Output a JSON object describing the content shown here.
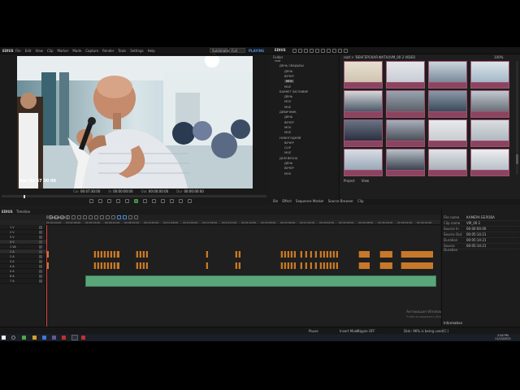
{
  "menubar": {
    "logo": "EDIUS",
    "items": [
      "File",
      "Edit",
      "View",
      "Clip",
      "Marker",
      "Mode",
      "Capture",
      "Render",
      "Tools",
      "Settings",
      "Help"
    ],
    "preset": "Sublimation vs.",
    "preset2": "Full",
    "badge": "PLAYING",
    "logo2": "EDIUS"
  },
  "preview": {
    "timecode": "Rec 03 47 30 00",
    "cur_label": "Cur",
    "cur_value": "00:47:30:00",
    "in_label": "In",
    "in_value": "00:00:00:00",
    "out_label": "Out",
    "out_value": "00:00:00:00",
    "dur_label": "Dur",
    "dur_value": "00:00:00:00"
  },
  "bin": {
    "tree_header": "Folder",
    "path": "root > 'ВЕНГЕРСКАЯ ФАТА/\\VM_00 2 VIDEO",
    "zoom": "100%",
    "tree": [
      {
        "label": "root",
        "level": 0
      },
      {
        "label": "ДЕНЬ СВАДЬБЫ",
        "level": 1
      },
      {
        "label": "ДЕНЬ",
        "level": 2
      },
      {
        "label": "ВЕЧЕР",
        "level": 2
      },
      {
        "label": "MOV",
        "level": 2
      },
      {
        "label": "MUZ",
        "level": 2
      },
      {
        "label": "БАНКЕТ ЗАГЛАВИЕ",
        "level": 1
      },
      {
        "label": "ДЕНЬ",
        "level": 2
      },
      {
        "label": "MOV",
        "level": 2
      },
      {
        "label": "MUZ",
        "level": 2
      },
      {
        "label": "ДЕВИЧНИК",
        "level": 1
      },
      {
        "label": "ДЕНЬ",
        "level": 2
      },
      {
        "label": "ВЕЧЕР",
        "level": 2
      },
      {
        "label": "MOV",
        "level": 2
      },
      {
        "label": "MUZ",
        "level": 2
      },
      {
        "label": "НОВОГОДНЯЯ",
        "level": 1
      },
      {
        "label": "ВЕЧЕР",
        "level": 2
      },
      {
        "label": "CLIP",
        "level": 2
      },
      {
        "label": "MUZ",
        "level": 2
      },
      {
        "label": "ДОМ ВЕСНА",
        "level": 1
      },
      {
        "label": "ДЕНЬ",
        "level": 2
      },
      {
        "label": "ВЕЧЕР",
        "level": 2
      },
      {
        "label": "MOV",
        "level": 2
      }
    ],
    "tabs_left": [
      "Bin",
      "Effect",
      "Sequence Marker",
      "Source Browser",
      "Clip"
    ],
    "tabs_right": [
      "Project",
      "View"
    ]
  },
  "timeline": {
    "title": "Timeline",
    "sequence": "0 Sequence 1",
    "ruler": [
      "00:00:00:00",
      "00:02:08:00",
      "00:04:16:00",
      "00:06:24:00",
      "00:08:32:00",
      "00:10:40:00",
      "00:12:48:00",
      "00:14:56:00",
      "00:17:04:00",
      "00:19:12:00",
      "00:21:20:00",
      "00:23:28:00",
      "00:25:36:00",
      "00:27:44:00",
      "00:29:52:00",
      "00:32:00:00",
      "00:34:08:00",
      "00:36:16:00",
      "00:38:24:00",
      "00:40:32:00"
    ],
    "tracks": [
      "1 V",
      "2 V",
      "3 V",
      "4 V",
      "1 VA",
      "1 A",
      "2 A",
      "3 A",
      "4 A",
      "5 A",
      "6 A",
      "7 A"
    ]
  },
  "props": {
    "rows": [
      {
        "k": "File name",
        "v": "КАМЕРА БЕЛОВА"
      },
      {
        "k": "Clip name",
        "v": "VM_00 2"
      },
      {
        "k": "Source In",
        "v": "00:00:00:00"
      },
      {
        "k": "Source Out",
        "v": "00:05:14:21"
      },
      {
        "k": "Duration",
        "v": "00:05:14:21"
      },
      {
        "k": "Source Duration",
        "v": "00:05:14:21"
      }
    ],
    "tab": "Information"
  },
  "status": {
    "left": "",
    "pause": "Pause",
    "insert": "Insert Mode",
    "ripple": "Ripple OFF",
    "disk": "Disk: 96% is being used(C:)"
  },
  "watermark": {
    "line1": "Активация Windows",
    "line2": "Чтобы активировать Windows, перейдите в раздел \"Параметры\"."
  },
  "taskbar": {
    "clock": "2:58 PM",
    "date": "11/15/2023"
  },
  "colors": {
    "clip_audio": "#c8782a",
    "clip_music": "#5aa67a",
    "thumb_frame": "#a0506e"
  }
}
